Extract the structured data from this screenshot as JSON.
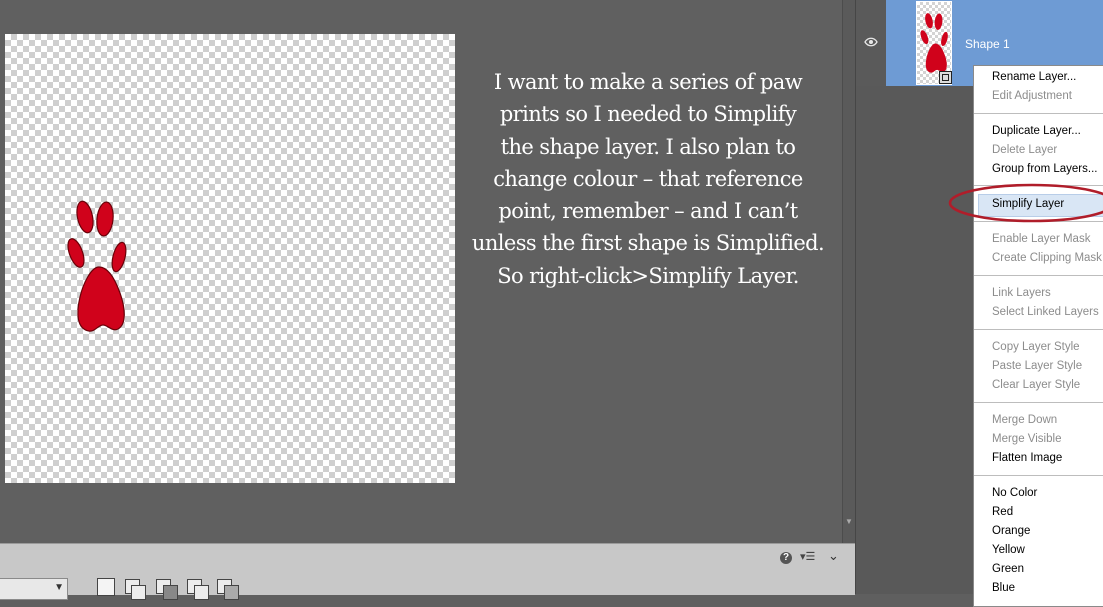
{
  "annotation": {
    "lines": [
      "I want to make a series of paw",
      "prints so I needed to Simplify",
      "the shape layer. I also plan to",
      "change colour – that reference",
      "point, remember – and I can’t",
      "unless the first shape is Simplified.",
      "So right-click>Simplify Layer."
    ]
  },
  "layer": {
    "name": "Shape 1",
    "visible": true
  },
  "context_menu": {
    "items": [
      {
        "label": "Rename Layer...",
        "enabled": true
      },
      {
        "label": "Edit Adjustment",
        "enabled": false
      },
      {
        "label": "Duplicate Layer...",
        "enabled": true
      },
      {
        "label": "Delete Layer",
        "enabled": false
      },
      {
        "label": "Group from Layers...",
        "enabled": true
      },
      {
        "label": "Simplify Layer",
        "enabled": true,
        "highlighted": true
      },
      {
        "label": "Enable Layer Mask",
        "enabled": false
      },
      {
        "label": "Create Clipping Mask",
        "enabled": false
      },
      {
        "label": "Link Layers",
        "enabled": false
      },
      {
        "label": "Select Linked Layers",
        "enabled": false
      },
      {
        "label": "Copy Layer Style",
        "enabled": false
      },
      {
        "label": "Paste Layer Style",
        "enabled": false
      },
      {
        "label": "Clear Layer Style",
        "enabled": false
      },
      {
        "label": "Merge Down",
        "enabled": false
      },
      {
        "label": "Merge Visible",
        "enabled": false
      },
      {
        "label": "Flatten Image",
        "enabled": true
      },
      {
        "label": "No Color",
        "enabled": true
      },
      {
        "label": "Red",
        "enabled": true
      },
      {
        "label": "Orange",
        "enabled": true
      },
      {
        "label": "Yellow",
        "enabled": true
      },
      {
        "label": "Green",
        "enabled": true
      },
      {
        "label": "Blue",
        "enabled": true
      }
    ]
  },
  "panel_icons": {
    "help": "?",
    "menu": "panel-menu-icon",
    "collapse": "chevron-down-icon"
  },
  "colors": {
    "paw": "#d0021b",
    "selection": "#6e9bd4",
    "highlight_ring": "#b01d2a",
    "menu_highlight": "#d9e6f5"
  }
}
